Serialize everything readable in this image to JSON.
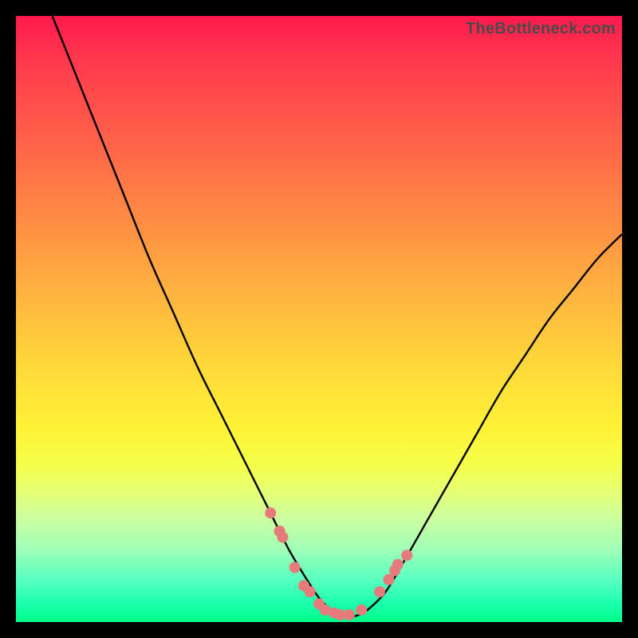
{
  "watermark": {
    "text": "TheBottleneck.com"
  },
  "colors": {
    "frame_bg": "#000000",
    "curve_stroke": "#000000",
    "dot_fill": "#e77b7b"
  },
  "chart_data": {
    "type": "line",
    "title": "",
    "xlabel": "",
    "ylabel": "",
    "xlim": [
      0,
      100
    ],
    "ylim": [
      0,
      100
    ],
    "series": [
      {
        "name": "curve",
        "x": [
          6,
          10,
          14,
          18,
          22,
          26,
          30,
          34,
          38,
          42,
          45,
          48,
          50,
          52,
          54,
          56,
          58,
          61,
          64,
          68,
          72,
          76,
          80,
          84,
          88,
          92,
          96,
          100
        ],
        "y": [
          100,
          90,
          80,
          70,
          60,
          51,
          42,
          34,
          26,
          18,
          12,
          7,
          4,
          2,
          1,
          1,
          2,
          5,
          10,
          17,
          24,
          31,
          38,
          44,
          50,
          55,
          60,
          64
        ]
      }
    ],
    "dots": {
      "name": "markers",
      "x": [
        42,
        43.5,
        44,
        46,
        47.5,
        48.5,
        50,
        51,
        52.5,
        53.5,
        55,
        57,
        60,
        61.5,
        62.5,
        63,
        64.5
      ],
      "y": [
        18,
        15,
        14,
        9,
        6,
        5,
        3,
        2,
        1.5,
        1.2,
        1.2,
        2,
        5,
        7,
        8.5,
        9.5,
        11
      ]
    }
  }
}
